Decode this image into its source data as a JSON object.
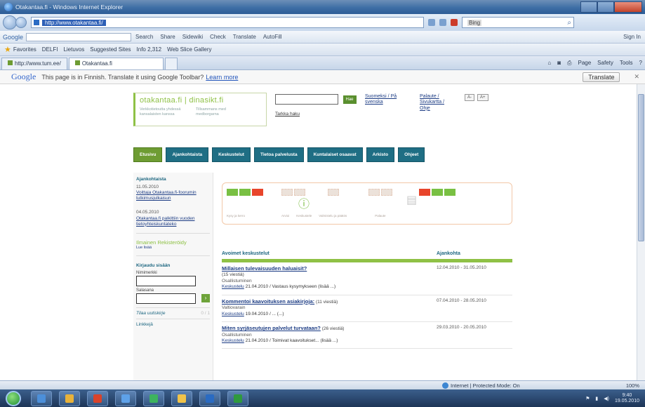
{
  "window": {
    "title": "Otakantaa.fi - Windows Internet Explorer"
  },
  "address": {
    "url": "http://www.otakantaa.fi/",
    "search_placeholder": "Bing"
  },
  "google_toolbar": {
    "label": "Google",
    "items": [
      "Search",
      "Share",
      "Sidewiki",
      "Check",
      "Translate",
      "AutoFill"
    ],
    "signin": "Sign In"
  },
  "favorites": {
    "label": "Favorites",
    "items": [
      "DELFI",
      "Lietuvos",
      "Suggested Sites",
      "Info 2,312",
      "Web Slice Gallery"
    ]
  },
  "tabs": {
    "tab1": "http://www.tum.ee/",
    "tab2": "Otakantaa.fi"
  },
  "cmdbar": {
    "page": "Page",
    "safety": "Safety",
    "tools": "Tools"
  },
  "translate_bar": {
    "logo": "Google",
    "message": "This page is in Finnish. Translate it using Google Toolbar?",
    "learn_more": "Learn more",
    "button": "Translate"
  },
  "site": {
    "logo": "otakantaa.fi | dinasikt.fi",
    "logo_sub_1": "Verkkotietoutta yhdessä kansalaisten kanssa",
    "logo_sub_2": "Tillsammans med medborgarna",
    "search_button": "Hae",
    "advanced_search": "Tarkka haku",
    "header_link_1": "Suomeksi / På svenska",
    "header_link_2": "Palaute / Sivukartta / Ohje",
    "font_small": "A-",
    "font_large": "A+"
  },
  "nav": [
    "Etusivu",
    "Ajankohtaista",
    "Keskustelut",
    "Tietoa palvelusta",
    "Kuntalaiset osaavat",
    "Arkisto",
    "Ohjeet"
  ],
  "left": {
    "news_heading": "Ajankohtaista",
    "news": [
      {
        "date": "11.05.2010",
        "text": "Voittaja Otakantaa.fi-foorumin tutkimusjulkaisun"
      },
      {
        "date": "04.05.2010",
        "text": "Otakantaa.fi palkittiin vuoden tietoyhteiskuntateko"
      }
    ],
    "register_main": "Rekisteröidy",
    "register_prefix": "Ilmainen",
    "register_small": "Lue lisää",
    "login_heading": "Kirjaudu sisään",
    "username_label": "Nimimerkki",
    "password_label": "Salasana",
    "go": "›",
    "subscribe": "Tilaa uutiskirje",
    "subscribe_count": "0 / 1",
    "more": "Linkkejä"
  },
  "banner_labels": [
    "Kysy ja kerro",
    "Arvioi",
    "Keskustele",
    "Valmistelu ja päätös",
    "Palaute"
  ],
  "results": {
    "col_title": "Avoimet keskustelut",
    "col_period": "Ajankohta",
    "rows": [
      {
        "title": "Millaisen tulevaisuuden haluaisit?",
        "tail": "(15 viestiä)",
        "sub": "Osallistuminen",
        "meta_link": "Keskustelu",
        "meta": "21.04.2010 / Vastaus kysymykseen (lisää ...)",
        "dates": "12.04.2010 - 31.05.2010"
      },
      {
        "title": "Kommentoi kaavoituksen asiakirjoja:",
        "tail": "(11 viestiä)",
        "sub": "Valtiovarain",
        "meta_link": "Keskustelu",
        "meta": "19.04.2010 / ... (...)",
        "dates": "07.04.2010 - 28.05.2010"
      },
      {
        "title": "Miten syrjäseutujen palvelut turvataan?",
        "tail": "(26 viestiä)",
        "sub": "Osallistuminen",
        "meta_link": "Keskustelu",
        "meta": "21.04.2010 / Toimivat kaavoitukset... (lisää ...)",
        "dates": "29.03.2010 - 20.05.2010"
      }
    ]
  },
  "status": {
    "zone": "Internet | Protected Mode: On",
    "zoom": "100%"
  },
  "clock": {
    "time": "9:40",
    "date": "19.05.2010"
  },
  "colors": {
    "nav_teal": "#1f6e84",
    "nav_active_green": "#6e9c33",
    "brand_green": "#8fc146",
    "banner_orange": "#e8452b"
  }
}
